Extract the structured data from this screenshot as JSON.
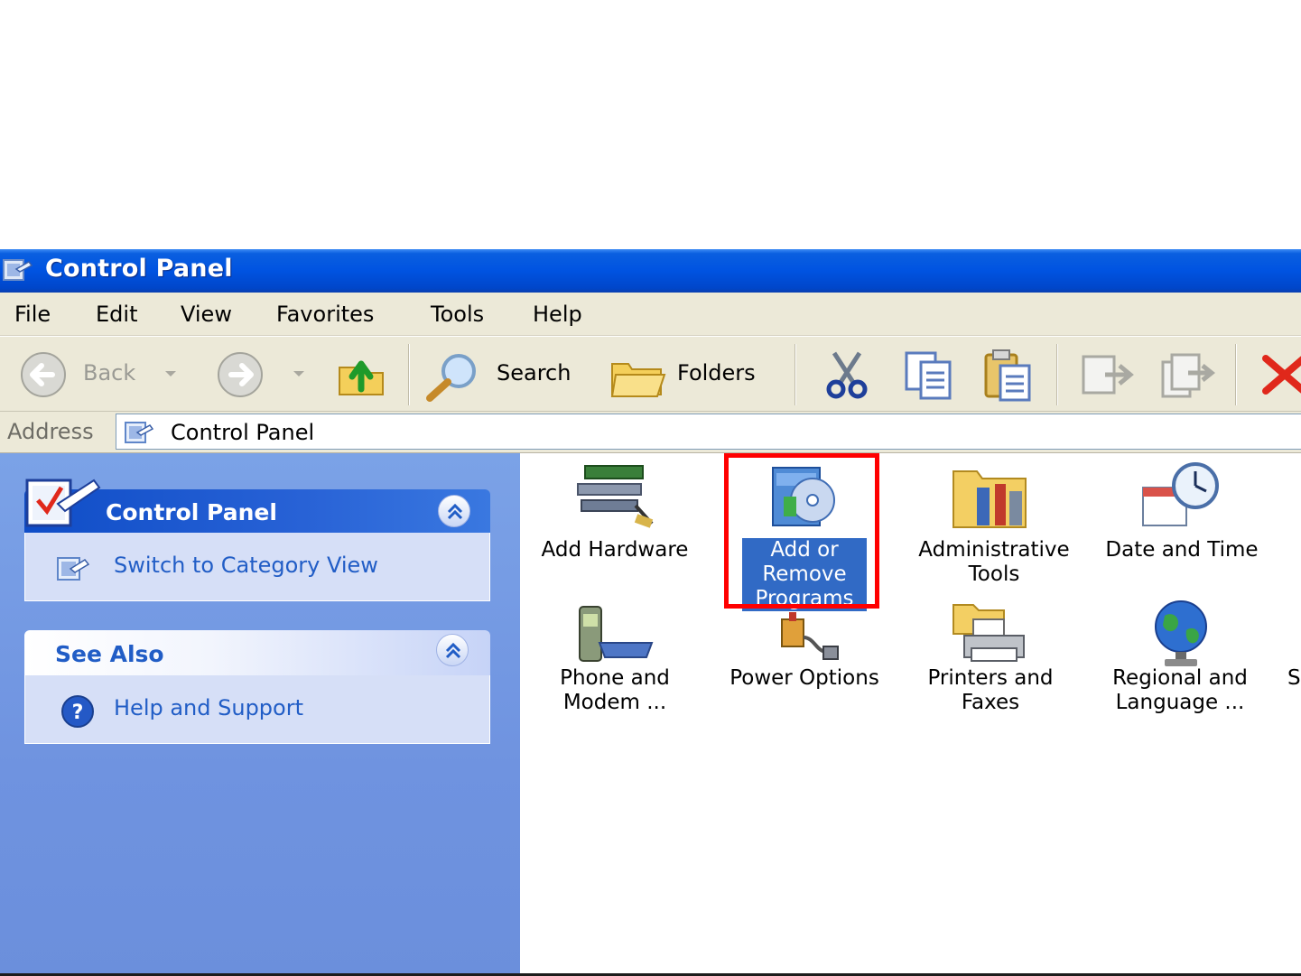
{
  "window": {
    "title": "Control Panel",
    "icon": "control-panel-icon"
  },
  "menu": [
    "File",
    "Edit",
    "View",
    "Favorites",
    "Tools",
    "Help"
  ],
  "toolbar": {
    "back_label": "Back",
    "search_label": "Search",
    "folders_label": "Folders",
    "icons": [
      "back-arrow-icon",
      "forward-arrow-icon",
      "up-folder-icon",
      "search-icon",
      "folders-icon",
      "cut-icon",
      "copy-icon",
      "paste-icon",
      "move-to-icon",
      "copy-to-icon",
      "delete-icon"
    ]
  },
  "address": {
    "label": "Address",
    "value": "Control Panel"
  },
  "taskpane": {
    "control_panel": {
      "title": "Control Panel",
      "link": "Switch to Category View"
    },
    "see_also": {
      "title": "See Also",
      "link": "Help and Support"
    }
  },
  "items": [
    {
      "label_lines": [
        "Add Hardware"
      ],
      "icon": "add-hardware-icon"
    },
    {
      "label_lines": [
        "Add or",
        "Remove",
        "Programs"
      ],
      "icon": "add-remove-programs-icon",
      "selected": true
    },
    {
      "label_lines": [
        "Administrative",
        "Tools"
      ],
      "icon": "administrative-tools-icon"
    },
    {
      "label_lines": [
        "Date and Time"
      ],
      "icon": "date-time-icon"
    },
    {
      "label_lines": [
        "Phone and",
        "Modem ..."
      ],
      "icon": "phone-modem-icon"
    },
    {
      "label_lines": [
        "Power Options"
      ],
      "icon": "power-options-icon"
    },
    {
      "label_lines": [
        "Printers and",
        "Faxes"
      ],
      "icon": "printers-faxes-icon"
    },
    {
      "label_lines": [
        "Regional and",
        "Language ..."
      ],
      "icon": "regional-language-icon"
    }
  ],
  "cutoff_text": "S",
  "colors": {
    "titlebar": "#0053e1",
    "selection": "#316ac5",
    "highlight_box": "#ff0000",
    "taskpane": "#7ba2e7",
    "link": "#215dc6"
  }
}
